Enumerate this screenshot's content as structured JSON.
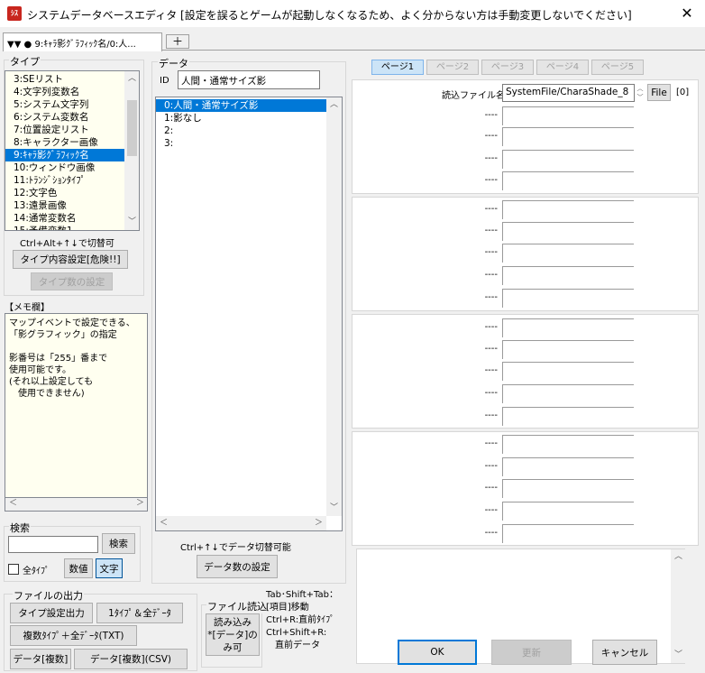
{
  "window": {
    "title": "システムデータベースエディタ [設定を誤るとゲームが起動しなくなるため、よく分からない方は手動変更しないでください]",
    "app_icon_text": "ｼｽ",
    "close_glyph": "✕"
  },
  "tabs": {
    "active_label": "▼▼ ● 9:ｷｬﾗ影ｸﾞﾗﾌｨｯｸ名/0:人...",
    "add_label": "＋"
  },
  "type_group": {
    "label": "タイプ",
    "items": [
      "3:SEリスト",
      "4:文字列変数名",
      "5:システム文字列",
      "6:システム変数名",
      "7:位置設定リスト",
      "8:キャラクター画像",
      "9:ｷｬﾗ影ｸﾞﾗﾌｨｯｸ名",
      "10:ウィンドウ画像",
      "11:ﾄﾗﾝｼﾞｼｮﾝﾀｲﾌﾟ",
      "12:文字色",
      "13:遠景画像",
      "14:通常変数名",
      "15:予備変数1"
    ],
    "selected_index": 6,
    "hint": "Ctrl+Alt+↑↓で切替可",
    "settings_button": "タイプ内容設定[危険!!]",
    "count_button": "タイプ数の設定"
  },
  "memo": {
    "label": "【メモ欄】",
    "text": "マップイベントで設定できる、\n「影グラフィック」の指定\n\n影番号は「255」番まで\n使用可能です。\n(それ以上設定しても\n　使用できません)"
  },
  "search": {
    "label": "検索",
    "input_value": "",
    "search_button": "検索",
    "all_types_label": "全ﾀｲﾌﾟ",
    "all_types_checked": false,
    "numeric_button": "数値",
    "text_button": "文字"
  },
  "file_output": {
    "label": "ファイルの出力",
    "type_settings_button": "タイプ設定出力",
    "one_type_all_data_button": "1ﾀｲﾌﾟ＆全ﾃﾞｰﾀ",
    "multi_type_txt_button": "複数ﾀｲﾌﾟ＋全ﾃﾞｰﾀ(TXT)",
    "data_multi_button": "データ[複数]",
    "data_multi_csv_button": "データ[複数](CSV)"
  },
  "file_read": {
    "label": "ファイル読込",
    "read_button": "読み込み\n*[データ]の\nみ可"
  },
  "shortcut_help": "Tab･Shift+Tab：\n[項目]移動\nCtrl+R:直前ﾀｲﾌﾟ\nCtrl+Shift+R:\n　直前データ",
  "data_group": {
    "label": "データ",
    "id_label": "ID",
    "id_value": "人間・通常サイズ影",
    "items": [
      "0:人間・通常サイズ影",
      "1:影なし",
      "2:",
      "3:"
    ],
    "selected_index": 0,
    "hint": "Ctrl+↑↓でデータ切替可能",
    "count_button": "データ数の設定"
  },
  "pages": {
    "tabs": [
      "ページ1",
      "ページ2",
      "ページ3",
      "ページ4",
      "ページ5"
    ],
    "active_index": 0
  },
  "content": {
    "file_label": "読込ファイル名",
    "file_value": "SystemFile/CharaShade_8",
    "file_button": "File",
    "file_index": "[0]",
    "placeholder_label": "----"
  },
  "dialog_buttons": {
    "ok": "OK",
    "update": "更新",
    "cancel": "キャンセル"
  },
  "scroll_glyphs": {
    "up": "︿",
    "down": "﹀",
    "left": "＜",
    "right": "＞"
  }
}
